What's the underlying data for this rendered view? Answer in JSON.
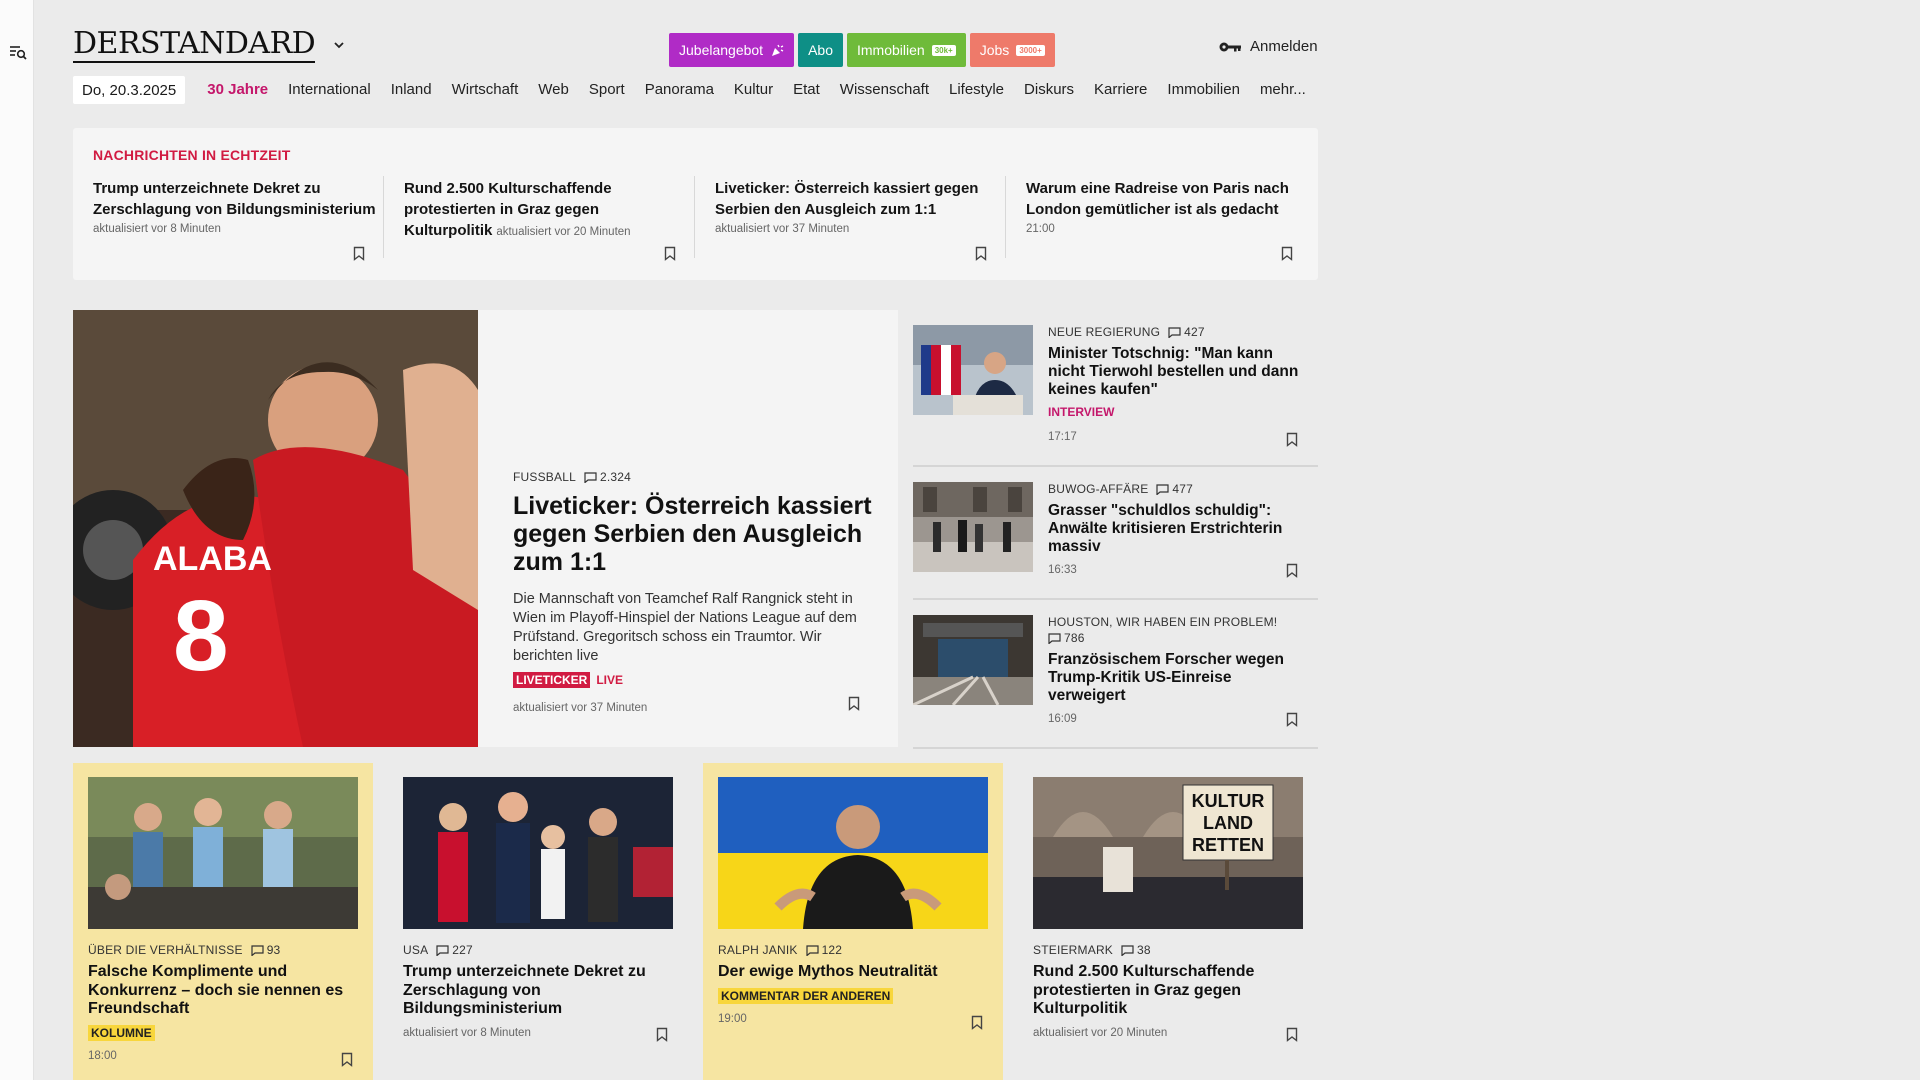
{
  "header": {
    "logo": "DERSTANDARD",
    "promos": [
      {
        "label": "Jubelangebot",
        "tag": ""
      },
      {
        "label": "Abo",
        "tag": ""
      },
      {
        "label": "Immobilien",
        "tag": "30k+"
      },
      {
        "label": "Jobs",
        "tag": "3000+"
      }
    ],
    "login": "Anmelden"
  },
  "nav": {
    "date": "Do, 20.3.2025",
    "items": [
      "30 Jahre",
      "International",
      "Inland",
      "Wirtschaft",
      "Web",
      "Sport",
      "Panorama",
      "Kultur",
      "Etat",
      "Wissenschaft",
      "Lifestyle",
      "Diskurs",
      "Karriere",
      "Immobilien",
      "mehr..."
    ]
  },
  "ticker": {
    "heading": "NACHRICHTEN IN ECHTZEIT",
    "items": [
      {
        "title": "Trump unterzeichnete Dekret zu Zerschlagung von Bildungsministerium",
        "meta": "aktualisiert vor 8 Minuten"
      },
      {
        "title": "Rund 2.500 Kulturschaffende protestierten in Graz gegen Kulturpolitik",
        "meta": "aktualisiert vor 20 Minuten"
      },
      {
        "title": "Liveticker: Österreich kassiert gegen Serbien den Ausgleich zum 1:1",
        "meta": "aktualisiert vor 37 Minuten"
      },
      {
        "title": "Warum eine Radreise von Paris nach London gemütlicher ist als gedacht",
        "meta": "21:00"
      }
    ]
  },
  "hero": {
    "kicker": "FUSSBALL",
    "comments": "2.324",
    "title": "Liveticker: Österreich kassiert gegen Serbien den Ausgleich zum 1:1",
    "teaser": "Die Mannschaft von Teamchef Ralf Rangnick steht in Wien im Playoff-Hinspiel der Nations League auf dem Prüfstand. Gregoritsch schoss ein Traumtor. Wir berichten live",
    "badge": "LIVETICKER",
    "live": "LIVE",
    "meta": "aktualisiert vor 37 Minuten",
    "shirt_name": "ALABA",
    "shirt_number": "8"
  },
  "side": [
    {
      "kicker": "NEUE REGIERUNG",
      "comments": "427",
      "title": "Minister Totschnig: \"Man kann nicht Tierwohl bestellen und dann keines kaufen\"",
      "tag": "INTERVIEW",
      "meta": "17:17"
    },
    {
      "kicker": "BUWOG-AFFÄRE",
      "comments": "477",
      "title": "Grasser \"schuldlos schuldig\": Anwälte kritisieren Erstrichterin massiv",
      "tag": "",
      "meta": "16:33"
    },
    {
      "kicker": "HOUSTON, WIR HABEN EIN PROBLEM!",
      "comments": "786",
      "title": "Französischem Forscher wegen Trump-Kritik US-Einreise verweigert",
      "tag": "",
      "meta": "16:09"
    }
  ],
  "cards": [
    {
      "kicker": "ÜBER DIE VERHÄLTNISSE",
      "comments": "93",
      "title": "Falsche Komplimente und Konkurrenz – doch sie nennen es Freundschaft",
      "label": "KOLUMNE",
      "meta": "18:00"
    },
    {
      "kicker": "USA",
      "comments": "227",
      "title": "Trump unterzeichnete Dekret zu Zerschlagung von Bildungsministerium",
      "label": "",
      "meta": "aktualisiert vor 8 Minuten"
    },
    {
      "kicker": "RALPH JANIK",
      "comments": "122",
      "title": "Der ewige Mythos Neutralität",
      "label": "KOMMENTAR DER ANDEREN",
      "meta": "19:00"
    },
    {
      "kicker": "STEIERMARK",
      "comments": "38",
      "title": "Rund 2.500 Kulturschaffende protestierten in Graz gegen Kulturpolitik",
      "label": "",
      "meta": "aktualisiert vor 20 Minuten"
    }
  ],
  "sign_text": "KULTUR LAND RETTEN",
  "colors": {
    "accent": "#c4176b",
    "live": "#d11b42",
    "highlight": "#f6e5a2"
  }
}
